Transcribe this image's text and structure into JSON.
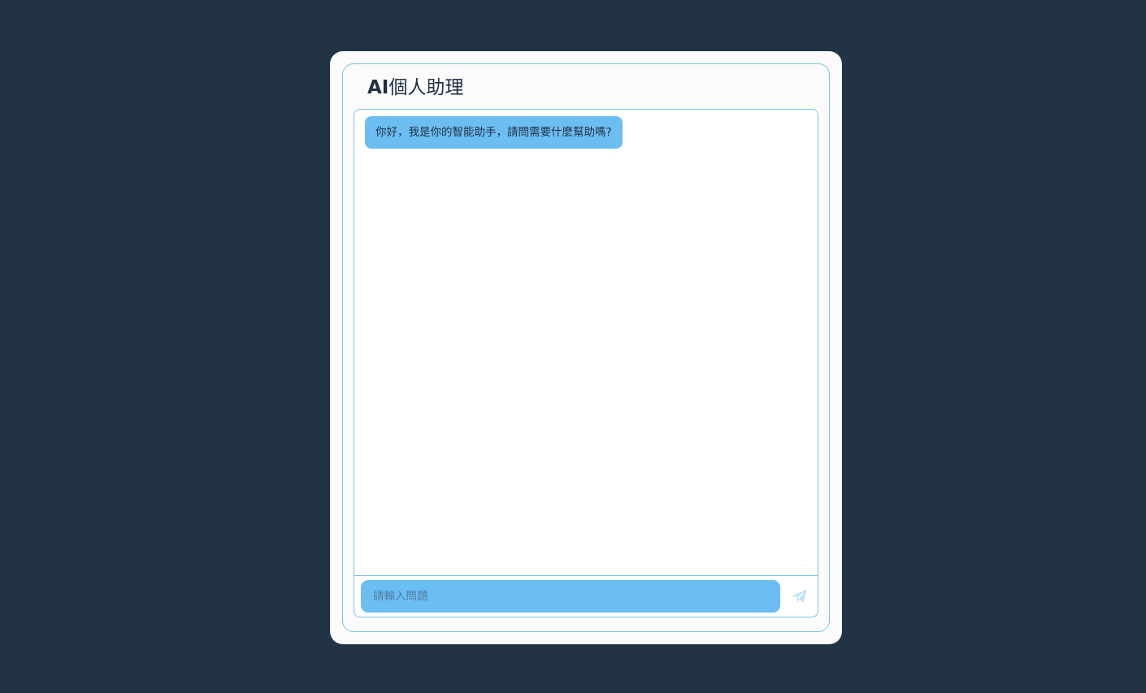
{
  "app": {
    "title_prefix": "AI",
    "title_suffix": "個人助理"
  },
  "chat": {
    "messages": [
      {
        "role": "assistant",
        "text": "你好，我是你的智能助手，請問需要什麼幫助嗎?"
      }
    ]
  },
  "composer": {
    "placeholder": "請輸入問題",
    "value": "",
    "send_icon": "paper-plane-icon"
  },
  "colors": {
    "page_background": "#223345",
    "card_background": "#fbfbfb",
    "border": "#7cc4e6",
    "bubble": "#6cbef2",
    "text": "#1e3045",
    "send_icon": "#bfe3f7"
  }
}
